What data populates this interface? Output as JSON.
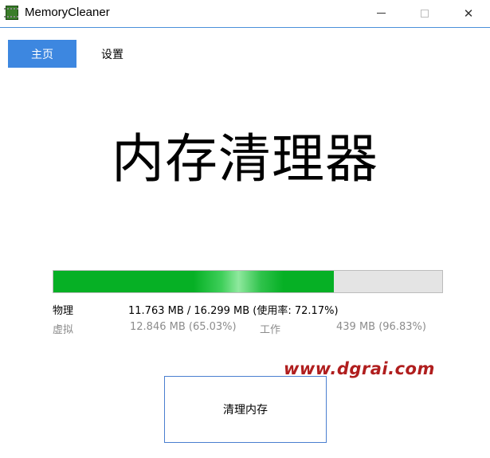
{
  "window": {
    "title": "MemoryCleaner",
    "icon": "memory-chip-icon",
    "minimize_glyph": "minimize-icon",
    "maximize_glyph": "maximize-icon",
    "close_glyph": "✕"
  },
  "nav": {
    "home_label": "主页",
    "settings_label": "设置"
  },
  "main": {
    "heading": "内存清理器"
  },
  "memory": {
    "usage_fraction": 0.7217,
    "physical_label": "物理",
    "physical_value": "11.763 MB / 16.299 MB (使用率: 72.17%)",
    "virtual_label": "虚拟",
    "virtual_value": "12.846 MB (65.03%)",
    "working_label": "工作",
    "working_value": "439 MB (96.83%)"
  },
  "watermark": "www.dgrai.com",
  "actions": {
    "clean_label": "清理内存"
  },
  "colors": {
    "accent": "#3d87e0",
    "progress_fill": "#06b025",
    "watermark": "#b01e1e"
  }
}
